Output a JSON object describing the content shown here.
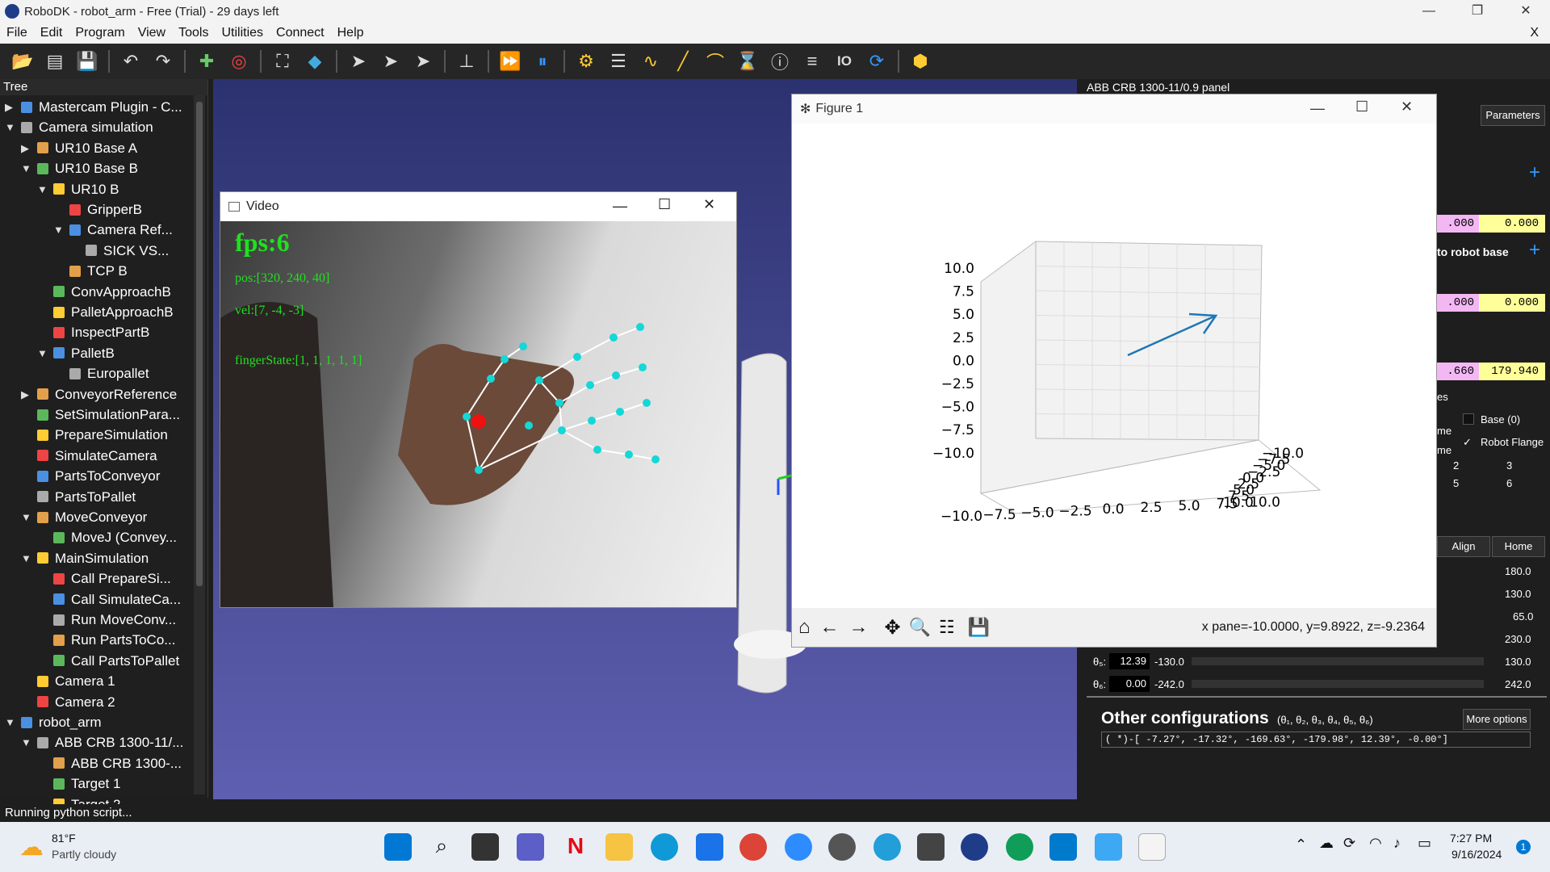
{
  "window": {
    "title": "RoboDK - robot_arm - Free (Trial) - 29 days left"
  },
  "menu": [
    "File",
    "Edit",
    "Program",
    "View",
    "Tools",
    "Utilities",
    "Connect",
    "Help"
  ],
  "menu_close": "X",
  "tree": {
    "header": "Tree",
    "items": [
      {
        "label": "Mastercam Plugin - C...",
        "level": 0,
        "arrow": "▶"
      },
      {
        "label": "Camera simulation",
        "level": 0,
        "arrow": "▼"
      },
      {
        "label": "UR10 Base A",
        "level": 1,
        "arrow": "▶"
      },
      {
        "label": "UR10 Base B",
        "level": 1,
        "arrow": "▼"
      },
      {
        "label": "UR10 B",
        "level": 2,
        "arrow": "▼"
      },
      {
        "label": "GripperB",
        "level": 3,
        "arrow": ""
      },
      {
        "label": "Camera Ref...",
        "level": 3,
        "arrow": "▼"
      },
      {
        "label": "SICK VS...",
        "level": 4,
        "arrow": ""
      },
      {
        "label": "TCP B",
        "level": 3,
        "arrow": ""
      },
      {
        "label": "ConvApproachB",
        "level": 2,
        "arrow": ""
      },
      {
        "label": "PalletApproachB",
        "level": 2,
        "arrow": ""
      },
      {
        "label": "InspectPartB",
        "level": 2,
        "arrow": ""
      },
      {
        "label": "PalletB",
        "level": 2,
        "arrow": "▼"
      },
      {
        "label": "Europallet",
        "level": 3,
        "arrow": ""
      },
      {
        "label": "ConveyorReference",
        "level": 1,
        "arrow": "▶"
      },
      {
        "label": "SetSimulationPara...",
        "level": 1,
        "arrow": ""
      },
      {
        "label": "PrepareSimulation",
        "level": 1,
        "arrow": ""
      },
      {
        "label": "SimulateCamera",
        "level": 1,
        "arrow": ""
      },
      {
        "label": "PartsToConveyor",
        "level": 1,
        "arrow": ""
      },
      {
        "label": "PartsToPallet",
        "level": 1,
        "arrow": ""
      },
      {
        "label": "MoveConveyor",
        "level": 1,
        "arrow": "▼"
      },
      {
        "label": "MoveJ (Convey...",
        "level": 2,
        "arrow": ""
      },
      {
        "label": "MainSimulation",
        "level": 1,
        "arrow": "▼"
      },
      {
        "label": "Call PrepareSi...",
        "level": 2,
        "arrow": ""
      },
      {
        "label": "Call SimulateCa...",
        "level": 2,
        "arrow": ""
      },
      {
        "label": "Run MoveConv...",
        "level": 2,
        "arrow": ""
      },
      {
        "label": "Run PartsToCo...",
        "level": 2,
        "arrow": ""
      },
      {
        "label": "Call PartsToPallet",
        "level": 2,
        "arrow": ""
      },
      {
        "label": "Camera 1",
        "level": 1,
        "arrow": ""
      },
      {
        "label": "Camera 2",
        "level": 1,
        "arrow": ""
      },
      {
        "label": "robot_arm",
        "level": 0,
        "arrow": "▼"
      },
      {
        "label": "ABB CRB 1300-11/...",
        "level": 1,
        "arrow": "▼"
      },
      {
        "label": "ABB CRB 1300-...",
        "level": 2,
        "arrow": ""
      },
      {
        "label": "Target 1",
        "level": 2,
        "arrow": ""
      },
      {
        "label": "Target 2",
        "level": 2,
        "arrow": ""
      }
    ]
  },
  "status": "Running python script...",
  "video": {
    "title": "Video",
    "fps": "fps:6",
    "pos": "pos:[320, 240, 40]",
    "vel": "vel:[7, -4, -3]",
    "finger": "fingerState:[1, 1, 1, 1, 1]"
  },
  "figure": {
    "title": "Figure 1",
    "coords": "x pane=-10.0000, y=9.8922, z=-9.2364",
    "z_ticks": [
      "10.0",
      "7.5",
      "5.0",
      "2.5",
      "0.0",
      "−2.5",
      "−5.0",
      "−7.5",
      "−10.0"
    ],
    "x_ticks": [
      "−10.0",
      "−7.5",
      "−5.0",
      "−2.5",
      "0.0",
      "2.5",
      "5.0",
      "7.5",
      "10.0"
    ],
    "y_ticks": [
      "−10.0",
      "−7.5",
      "−5.0",
      "−2.5",
      "0.0",
      "2.5",
      "5.0",
      "7.5",
      "10.0"
    ]
  },
  "panel": {
    "title": "ABB CRB 1300-11/0.9 panel",
    "parameters": "Parameters",
    "robot_base": "to robot base",
    "yellow_vals": [
      "0.000",
      "0.000",
      "179.940"
    ],
    "pink_vals": [
      ".000",
      ".000",
      ".660"
    ],
    "checks": [
      "Base (0)",
      "Robot Flange"
    ],
    "check_me": [
      "me",
      "me"
    ],
    "es": "es",
    "config_nums": [
      "2",
      "3",
      "5",
      "6"
    ],
    "align": "Align",
    "home": "Home",
    "joint_max": [
      "180.0",
      "130.0",
      "65.0",
      "230.0",
      "130.0",
      "242.0"
    ],
    "j5": {
      "label": "θ₅:",
      "value": "12.39",
      "min": "-130.0"
    },
    "j6": {
      "label": "θ₆:",
      "value": "0.00",
      "min": "-242.0"
    },
    "other_title": "Other configurations",
    "other_sub": "(θ₁, θ₂, θ₃, θ₄, θ₅, θ₆)",
    "more": "More options",
    "config_row": "( *)-[  -7.27°,  -17.32°, -169.63°, -179.98°,   12.39°,   -0.00°]"
  },
  "taskbar": {
    "temp": "81°F",
    "weather": "Partly cloudy",
    "time": "7:27 PM",
    "date": "9/16/2024",
    "badge": "1"
  }
}
